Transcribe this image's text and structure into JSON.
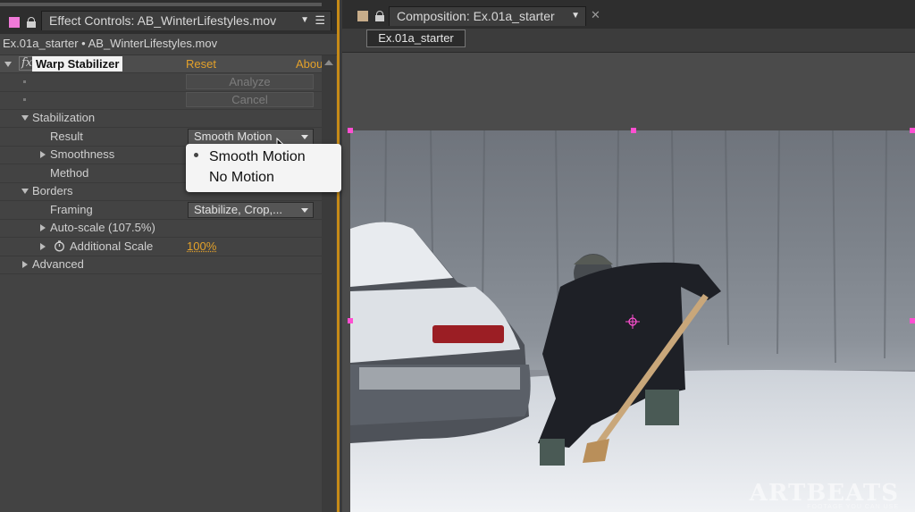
{
  "left_panel": {
    "tab_title": "Effect Controls: AB_WinterLifestyles.mov",
    "breadcrumb": "Ex.01a_starter • AB_WinterLifestyles.mov",
    "effect": {
      "fx_label": "fx",
      "name": "Warp Stabilizer",
      "reset_label": "Reset",
      "about_label": "Abou"
    },
    "analyze_label": "Analyze",
    "cancel_label": "Cancel",
    "stabilization": {
      "label": "Stabilization",
      "result_label": "Result",
      "result_value": "Smooth Motion",
      "smoothness_label": "Smoothness",
      "method_label": "Method"
    },
    "borders": {
      "label": "Borders",
      "framing_label": "Framing",
      "framing_value": "Stabilize, Crop,...",
      "autoscale_label": "Auto-scale (107.5%)",
      "additional_scale_label": "Additional Scale",
      "additional_scale_value": "100%"
    },
    "advanced_label": "Advanced"
  },
  "popup_menu": {
    "items": [
      {
        "label": "Smooth Motion",
        "selected": true
      },
      {
        "label": "No Motion",
        "selected": false
      }
    ]
  },
  "right_panel": {
    "tab_title": "Composition: Ex.01a_starter",
    "comp_chip": "Ex.01a_starter"
  },
  "video": {
    "watermark": "ARTBEATS",
    "watermark_sub": "FOOTAGE YOU CAN USE"
  },
  "colors": {
    "accent": "#e3a12a",
    "handle": "#ff4fd1"
  }
}
